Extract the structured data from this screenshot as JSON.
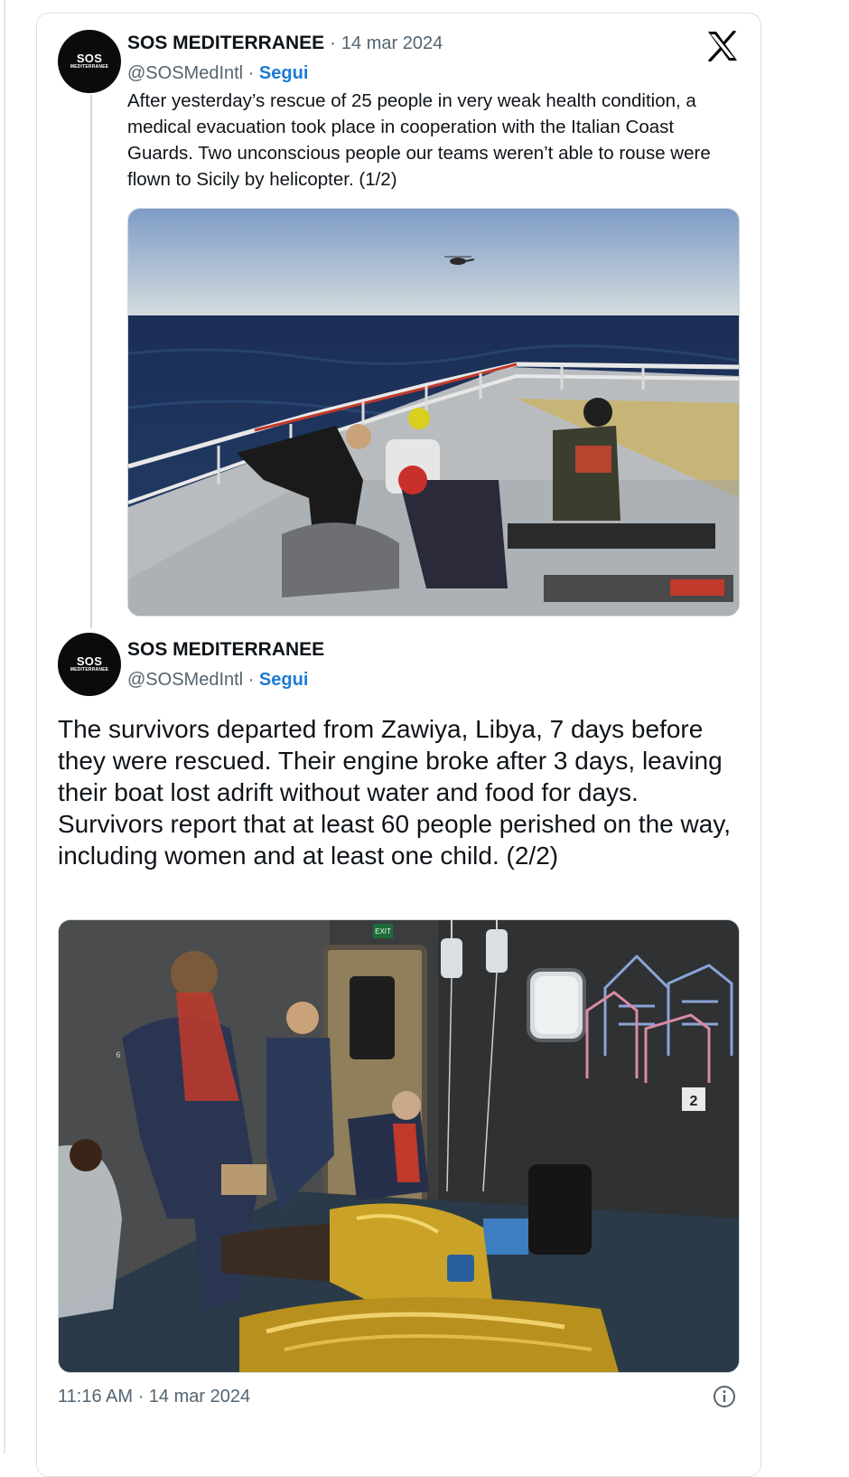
{
  "tweet1": {
    "author_name": "SOS MEDITERRANEE",
    "separator": "·",
    "date": "14 mar 2024",
    "handle": "@SOSMedIntl",
    "handle_separator": "·",
    "follow_label": "Segui",
    "avatar_text_top": "SOS",
    "avatar_text_bottom": "MEDITERRANEE",
    "text": "After yesterday’s rescue of 25 people in very weak health condition, a medical evacuation took place in cooperation with the Italian Coast Guards. Two unconscious people our teams weren’t able to rouse were flown to Sicily by helicopter. (1/2)"
  },
  "tweet2": {
    "author_name": "SOS MEDITERRANEE",
    "handle": "@SOSMedIntl",
    "handle_separator": "·",
    "follow_label": "Segui",
    "avatar_text_top": "SOS",
    "avatar_text_bottom": "MEDITERRANEE",
    "text": "The survivors departed from Zawiya, Libya, 7 days before they were rescued. Their engine broke after 3 days, leaving their boat lost adrift without water and food for days. Survivors report that at least 60 people perished on the way, including women and at least one child. (2/2)"
  },
  "photo2_signs": {
    "exit": "EXIT",
    "number": "2",
    "small_number": "6"
  },
  "footer": {
    "timestamp": "11:16 AM · 14 mar 2024"
  },
  "icons": {
    "platform": "x-logo-icon",
    "info": "info-icon"
  },
  "colors": {
    "link": "#1d7bd4",
    "secondary_text": "#536471",
    "avatar_bg": "#0b0b0b"
  }
}
